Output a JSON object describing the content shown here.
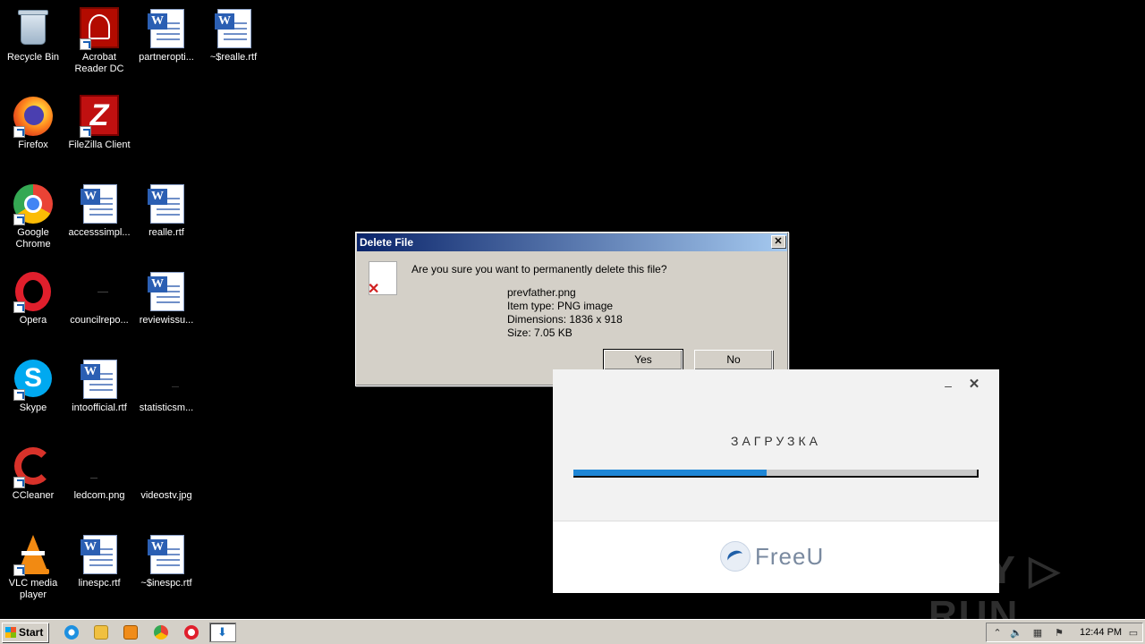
{
  "desktop": {
    "icons": [
      {
        "label": "Recycle Bin",
        "icon": "recycle-bin-icon"
      },
      {
        "label": "Acrobat Reader DC",
        "icon": "acrobat-icon"
      },
      {
        "label": "partneropti...",
        "icon": "word-doc-icon"
      },
      {
        "label": "~$realle.rtf",
        "icon": "word-doc-icon"
      },
      {
        "label": "Firefox",
        "icon": "firefox-icon"
      },
      {
        "label": "FileZilla Client",
        "icon": "filezilla-icon"
      },
      {
        "label": "Google Chrome",
        "icon": "chrome-icon"
      },
      {
        "label": "accesssimpl...",
        "icon": "word-doc-icon"
      },
      {
        "label": "realle.rtf",
        "icon": "word-doc-icon"
      },
      {
        "label": "Opera",
        "icon": "opera-icon"
      },
      {
        "label": "councilrepo...",
        "icon": "image-file-icon"
      },
      {
        "label": "reviewissu...",
        "icon": "word-doc-icon"
      },
      {
        "label": "Skype",
        "icon": "skype-icon"
      },
      {
        "label": "intoofficial.rtf",
        "icon": "word-doc-icon"
      },
      {
        "label": "statisticsm...",
        "icon": "image-file-icon"
      },
      {
        "label": "CCleaner",
        "icon": "ccleaner-icon"
      },
      {
        "label": "ledcom.png",
        "icon": "image-file-icon"
      },
      {
        "label": "videostv.jpg",
        "icon": "image-file-icon"
      },
      {
        "label": "VLC media player",
        "icon": "vlc-icon"
      },
      {
        "label": "linespc.rtf",
        "icon": "word-doc-icon"
      },
      {
        "label": "~$inespc.rtf",
        "icon": "word-doc-icon"
      }
    ]
  },
  "delete_dialog": {
    "title": "Delete File",
    "close": "✕",
    "question": "Are you sure you want to permanently delete this file?",
    "file_name": "prevfather.png",
    "item_type": "Item type: PNG image",
    "dimensions": "Dimensions: 1836 x 918",
    "size": "Size: 7.05 KB",
    "yes": "Yes",
    "no": "No"
  },
  "freeu": {
    "minimize": "–",
    "close": "✕",
    "loading_text": "ЗАГРУЗКА",
    "progress": 0.48,
    "progress_color": "#1e86d6",
    "brand": "FreeU"
  },
  "watermark": "ANY ▷ RUN",
  "taskbar": {
    "start_label": "Start",
    "clock": "12:44 PM"
  }
}
